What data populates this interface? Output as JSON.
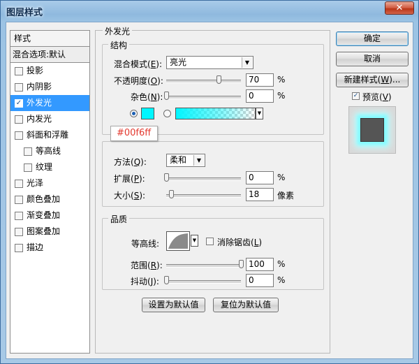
{
  "window": {
    "title": "图层样式",
    "close_glyph": "✕"
  },
  "styles_panel": {
    "header": "样式",
    "blend_options": "混合选项:默认",
    "items": [
      {
        "label": "投影",
        "checked": false,
        "sub": false,
        "selected": false
      },
      {
        "label": "内阴影",
        "checked": false,
        "sub": false,
        "selected": false
      },
      {
        "label": "外发光",
        "checked": true,
        "sub": false,
        "selected": true
      },
      {
        "label": "内发光",
        "checked": false,
        "sub": false,
        "selected": false
      },
      {
        "label": "斜面和浮雕",
        "checked": false,
        "sub": false,
        "selected": false
      },
      {
        "label": "等高线",
        "checked": false,
        "sub": true,
        "selected": false
      },
      {
        "label": "纹理",
        "checked": false,
        "sub": true,
        "selected": false
      },
      {
        "label": "光泽",
        "checked": false,
        "sub": false,
        "selected": false
      },
      {
        "label": "颜色叠加",
        "checked": false,
        "sub": false,
        "selected": false
      },
      {
        "label": "渐变叠加",
        "checked": false,
        "sub": false,
        "selected": false
      },
      {
        "label": "图案叠加",
        "checked": false,
        "sub": false,
        "selected": false
      },
      {
        "label": "描边",
        "checked": false,
        "sub": false,
        "selected": false
      }
    ]
  },
  "outer_glow": {
    "group_title": "外发光",
    "structure": {
      "title": "结构",
      "blend_mode": {
        "label_pre": "混合模式(",
        "key": "E",
        "label_post": "):",
        "value": "亮光"
      },
      "opacity": {
        "label_pre": "不透明度(",
        "key": "O",
        "label_post": "):",
        "value": "70",
        "unit": "%",
        "level": 0.7
      },
      "noise": {
        "label_pre": "杂色(",
        "key": "N",
        "label_post": "):",
        "value": "0",
        "unit": "%",
        "level": 0.0
      },
      "color_swatch": "#00f6ff",
      "color_mode": "solid",
      "color_tooltip": "#00f6ff"
    },
    "elements": {
      "technique": {
        "label_pre": "方法(",
        "key": "Q",
        "label_post": "):",
        "value": "柔和"
      },
      "spread": {
        "label_pre": "扩展(",
        "key": "P",
        "label_post": "):",
        "value": "0",
        "unit": "%",
        "level": 0.0
      },
      "size": {
        "label_pre": "大小(",
        "key": "S",
        "label_post": "):",
        "value": "18",
        "unit": "像素",
        "level": 0.07
      }
    },
    "quality": {
      "title": "品质",
      "contour_label": "等高线:",
      "anti_alias": {
        "label_pre": "消除锯齿(",
        "key": "L",
        "label_post": ")",
        "checked": false
      },
      "range": {
        "label_pre": "范围(",
        "key": "R",
        "label_post": "):",
        "value": "100",
        "unit": "%",
        "level": 1.0
      },
      "jitter": {
        "label_pre": "抖动(",
        "key": "J",
        "label_post": "):",
        "value": "0",
        "unit": "%",
        "level": 0.0
      }
    },
    "make_default": "设置为默认值",
    "reset_default": "复位为默认值"
  },
  "buttons": {
    "ok": "确定",
    "cancel": "取消",
    "new_style": {
      "label_pre": "新建样式(",
      "key": "W",
      "label_post": ")..."
    },
    "preview": {
      "label_pre": "预览(",
      "key": "V",
      "label_post": ")",
      "checked": true
    }
  },
  "icons": {
    "check": "✓",
    "dropdown": "▼",
    "swatch_color": "#00f6ff",
    "glow_color": "#84fbff"
  }
}
